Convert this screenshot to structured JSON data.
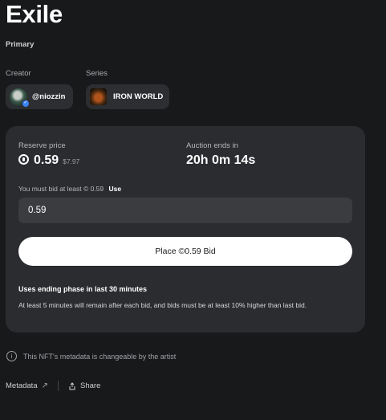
{
  "title": "Exile",
  "edition": "Primary",
  "creator": {
    "label": "Creator",
    "handle": "@niozzin"
  },
  "series": {
    "label": "Series",
    "name": "IRON WORLD"
  },
  "auction": {
    "reserve_label": "Reserve price",
    "reserve_value": "0.59",
    "reserve_usd": "$7.97",
    "ends_label": "Auction ends in",
    "ends_value": "20h 0m 14s",
    "min_bid_text": "You must bid at least © 0.59",
    "use_label": "Use",
    "bid_input_value": "0.59",
    "place_bid_label": "Place ©0.59 Bid",
    "phase_title": "Uses ending phase in last 30 minutes",
    "phase_desc": "At least 5 minutes will remain after each bid, and bids must be at least 10% higher than last bid."
  },
  "metadata_notice": "This NFT's metadata is changeable by the artist",
  "footer": {
    "metadata_label": "Metadata",
    "share_label": "Share"
  },
  "icons": [
    "info-icon",
    "external-link-icon",
    "share-icon",
    "currency-icon",
    "verified-badge-icon"
  ],
  "colors": {
    "background": "#18191b",
    "panel": "#2a2c2f",
    "chip": "#2c2e31",
    "input": "#3a3c40",
    "button": "#ffffff"
  }
}
